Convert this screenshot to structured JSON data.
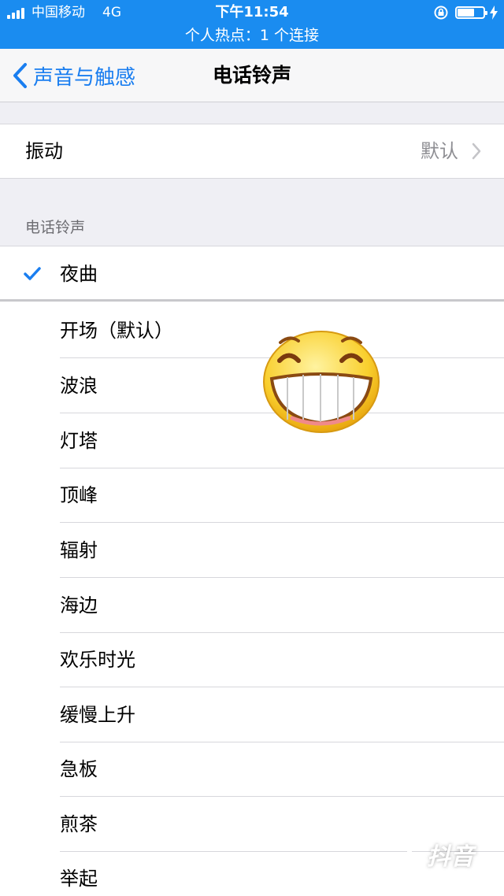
{
  "status_bar": {
    "carrier": "中国移动",
    "network": "4G",
    "time": "下午11:54",
    "hotspot": "个人热点：1 个连接",
    "battery_level": 0.7
  },
  "nav": {
    "back_label": "声音与触感",
    "title": "电话铃声"
  },
  "vibration": {
    "label": "振动",
    "value": "默认"
  },
  "section_header": "电话铃声",
  "ringtones": [
    {
      "label": "夜曲",
      "selected": true
    },
    {
      "label": "开场（默认）",
      "selected": false
    },
    {
      "label": "波浪",
      "selected": false
    },
    {
      "label": "灯塔",
      "selected": false
    },
    {
      "label": "顶峰",
      "selected": false
    },
    {
      "label": "辐射",
      "selected": false
    },
    {
      "label": "海边",
      "selected": false
    },
    {
      "label": "欢乐时光",
      "selected": false
    },
    {
      "label": "缓慢上升",
      "selected": false
    },
    {
      "label": "急板",
      "selected": false
    },
    {
      "label": "煎茶",
      "selected": false
    },
    {
      "label": "举起",
      "selected": false
    }
  ],
  "watermark": "抖音",
  "colors": {
    "status_bar": "#1a8cf0",
    "accent": "#1a7ef0",
    "secondary_text": "#8e8e93",
    "background": "#efeff4"
  }
}
